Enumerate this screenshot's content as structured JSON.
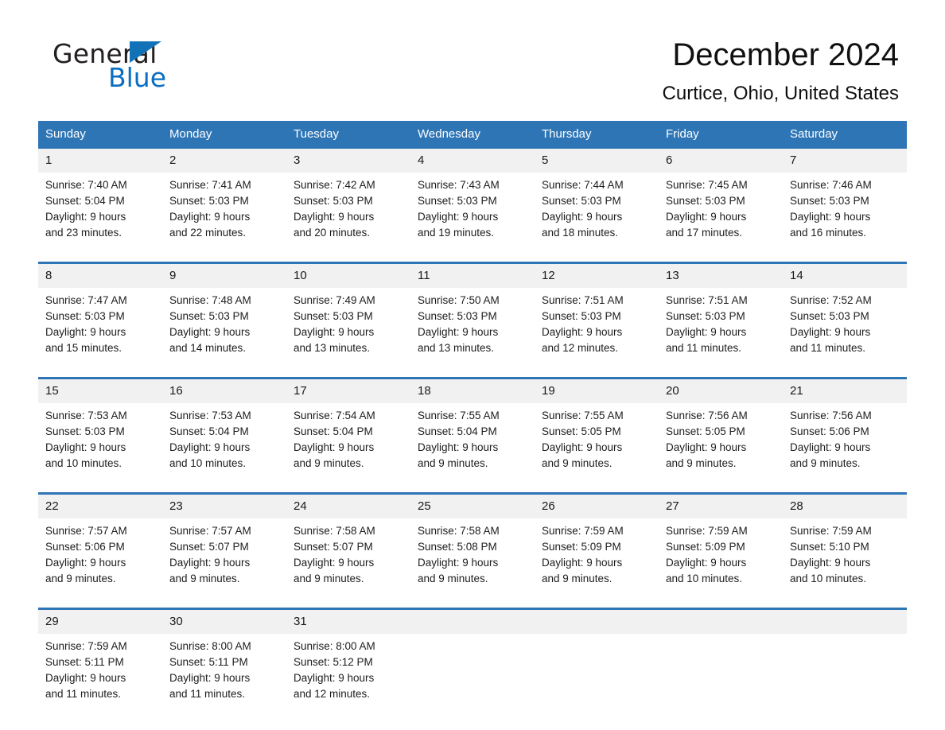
{
  "brand": {
    "name_part1": "General",
    "name_part2": "Blue",
    "accent_color": "#2e75b6",
    "logo_blue": "#0a6fc2",
    "header_bg": "#2e75b6",
    "daynum_bg": "#f1f1f1"
  },
  "header": {
    "title": "December 2024",
    "subtitle": "Curtice, Ohio, United States"
  },
  "weekdays": [
    "Sunday",
    "Monday",
    "Tuesday",
    "Wednesday",
    "Thursday",
    "Friday",
    "Saturday"
  ],
  "weeks": [
    {
      "days": [
        {
          "num": "1",
          "sunrise": "Sunrise: 7:40 AM",
          "sunset": "Sunset: 5:04 PM",
          "daylight_l1": "Daylight: 9 hours",
          "daylight_l2": "and 23 minutes."
        },
        {
          "num": "2",
          "sunrise": "Sunrise: 7:41 AM",
          "sunset": "Sunset: 5:03 PM",
          "daylight_l1": "Daylight: 9 hours",
          "daylight_l2": "and 22 minutes."
        },
        {
          "num": "3",
          "sunrise": "Sunrise: 7:42 AM",
          "sunset": "Sunset: 5:03 PM",
          "daylight_l1": "Daylight: 9 hours",
          "daylight_l2": "and 20 minutes."
        },
        {
          "num": "4",
          "sunrise": "Sunrise: 7:43 AM",
          "sunset": "Sunset: 5:03 PM",
          "daylight_l1": "Daylight: 9 hours",
          "daylight_l2": "and 19 minutes."
        },
        {
          "num": "5",
          "sunrise": "Sunrise: 7:44 AM",
          "sunset": "Sunset: 5:03 PM",
          "daylight_l1": "Daylight: 9 hours",
          "daylight_l2": "and 18 minutes."
        },
        {
          "num": "6",
          "sunrise": "Sunrise: 7:45 AM",
          "sunset": "Sunset: 5:03 PM",
          "daylight_l1": "Daylight: 9 hours",
          "daylight_l2": "and 17 minutes."
        },
        {
          "num": "7",
          "sunrise": "Sunrise: 7:46 AM",
          "sunset": "Sunset: 5:03 PM",
          "daylight_l1": "Daylight: 9 hours",
          "daylight_l2": "and 16 minutes."
        }
      ]
    },
    {
      "days": [
        {
          "num": "8",
          "sunrise": "Sunrise: 7:47 AM",
          "sunset": "Sunset: 5:03 PM",
          "daylight_l1": "Daylight: 9 hours",
          "daylight_l2": "and 15 minutes."
        },
        {
          "num": "9",
          "sunrise": "Sunrise: 7:48 AM",
          "sunset": "Sunset: 5:03 PM",
          "daylight_l1": "Daylight: 9 hours",
          "daylight_l2": "and 14 minutes."
        },
        {
          "num": "10",
          "sunrise": "Sunrise: 7:49 AM",
          "sunset": "Sunset: 5:03 PM",
          "daylight_l1": "Daylight: 9 hours",
          "daylight_l2": "and 13 minutes."
        },
        {
          "num": "11",
          "sunrise": "Sunrise: 7:50 AM",
          "sunset": "Sunset: 5:03 PM",
          "daylight_l1": "Daylight: 9 hours",
          "daylight_l2": "and 13 minutes."
        },
        {
          "num": "12",
          "sunrise": "Sunrise: 7:51 AM",
          "sunset": "Sunset: 5:03 PM",
          "daylight_l1": "Daylight: 9 hours",
          "daylight_l2": "and 12 minutes."
        },
        {
          "num": "13",
          "sunrise": "Sunrise: 7:51 AM",
          "sunset": "Sunset: 5:03 PM",
          "daylight_l1": "Daylight: 9 hours",
          "daylight_l2": "and 11 minutes."
        },
        {
          "num": "14",
          "sunrise": "Sunrise: 7:52 AM",
          "sunset": "Sunset: 5:03 PM",
          "daylight_l1": "Daylight: 9 hours",
          "daylight_l2": "and 11 minutes."
        }
      ]
    },
    {
      "days": [
        {
          "num": "15",
          "sunrise": "Sunrise: 7:53 AM",
          "sunset": "Sunset: 5:03 PM",
          "daylight_l1": "Daylight: 9 hours",
          "daylight_l2": "and 10 minutes."
        },
        {
          "num": "16",
          "sunrise": "Sunrise: 7:53 AM",
          "sunset": "Sunset: 5:04 PM",
          "daylight_l1": "Daylight: 9 hours",
          "daylight_l2": "and 10 minutes."
        },
        {
          "num": "17",
          "sunrise": "Sunrise: 7:54 AM",
          "sunset": "Sunset: 5:04 PM",
          "daylight_l1": "Daylight: 9 hours",
          "daylight_l2": "and 9 minutes."
        },
        {
          "num": "18",
          "sunrise": "Sunrise: 7:55 AM",
          "sunset": "Sunset: 5:04 PM",
          "daylight_l1": "Daylight: 9 hours",
          "daylight_l2": "and 9 minutes."
        },
        {
          "num": "19",
          "sunrise": "Sunrise: 7:55 AM",
          "sunset": "Sunset: 5:05 PM",
          "daylight_l1": "Daylight: 9 hours",
          "daylight_l2": "and 9 minutes."
        },
        {
          "num": "20",
          "sunrise": "Sunrise: 7:56 AM",
          "sunset": "Sunset: 5:05 PM",
          "daylight_l1": "Daylight: 9 hours",
          "daylight_l2": "and 9 minutes."
        },
        {
          "num": "21",
          "sunrise": "Sunrise: 7:56 AM",
          "sunset": "Sunset: 5:06 PM",
          "daylight_l1": "Daylight: 9 hours",
          "daylight_l2": "and 9 minutes."
        }
      ]
    },
    {
      "days": [
        {
          "num": "22",
          "sunrise": "Sunrise: 7:57 AM",
          "sunset": "Sunset: 5:06 PM",
          "daylight_l1": "Daylight: 9 hours",
          "daylight_l2": "and 9 minutes."
        },
        {
          "num": "23",
          "sunrise": "Sunrise: 7:57 AM",
          "sunset": "Sunset: 5:07 PM",
          "daylight_l1": "Daylight: 9 hours",
          "daylight_l2": "and 9 minutes."
        },
        {
          "num": "24",
          "sunrise": "Sunrise: 7:58 AM",
          "sunset": "Sunset: 5:07 PM",
          "daylight_l1": "Daylight: 9 hours",
          "daylight_l2": "and 9 minutes."
        },
        {
          "num": "25",
          "sunrise": "Sunrise: 7:58 AM",
          "sunset": "Sunset: 5:08 PM",
          "daylight_l1": "Daylight: 9 hours",
          "daylight_l2": "and 9 minutes."
        },
        {
          "num": "26",
          "sunrise": "Sunrise: 7:59 AM",
          "sunset": "Sunset: 5:09 PM",
          "daylight_l1": "Daylight: 9 hours",
          "daylight_l2": "and 9 minutes."
        },
        {
          "num": "27",
          "sunrise": "Sunrise: 7:59 AM",
          "sunset": "Sunset: 5:09 PM",
          "daylight_l1": "Daylight: 9 hours",
          "daylight_l2": "and 10 minutes."
        },
        {
          "num": "28",
          "sunrise": "Sunrise: 7:59 AM",
          "sunset": "Sunset: 5:10 PM",
          "daylight_l1": "Daylight: 9 hours",
          "daylight_l2": "and 10 minutes."
        }
      ]
    },
    {
      "days": [
        {
          "num": "29",
          "sunrise": "Sunrise: 7:59 AM",
          "sunset": "Sunset: 5:11 PM",
          "daylight_l1": "Daylight: 9 hours",
          "daylight_l2": "and 11 minutes."
        },
        {
          "num": "30",
          "sunrise": "Sunrise: 8:00 AM",
          "sunset": "Sunset: 5:11 PM",
          "daylight_l1": "Daylight: 9 hours",
          "daylight_l2": "and 11 minutes."
        },
        {
          "num": "31",
          "sunrise": "Sunrise: 8:00 AM",
          "sunset": "Sunset: 5:12 PM",
          "daylight_l1": "Daylight: 9 hours",
          "daylight_l2": "and 12 minutes."
        },
        {
          "num": "",
          "sunrise": "",
          "sunset": "",
          "daylight_l1": "",
          "daylight_l2": ""
        },
        {
          "num": "",
          "sunrise": "",
          "sunset": "",
          "daylight_l1": "",
          "daylight_l2": ""
        },
        {
          "num": "",
          "sunrise": "",
          "sunset": "",
          "daylight_l1": "",
          "daylight_l2": ""
        },
        {
          "num": "",
          "sunrise": "",
          "sunset": "",
          "daylight_l1": "",
          "daylight_l2": ""
        }
      ]
    }
  ]
}
